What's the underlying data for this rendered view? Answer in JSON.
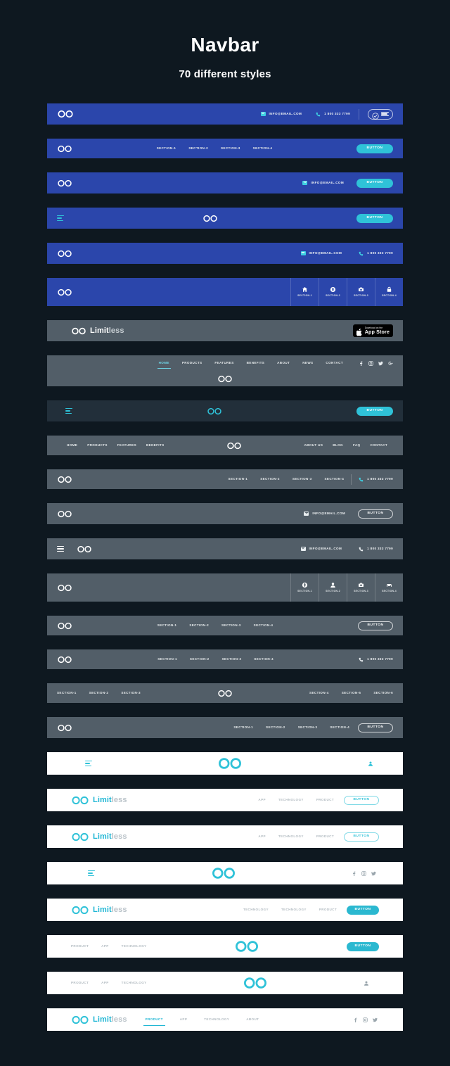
{
  "header": {
    "title": "Navbar",
    "subtitle": "70 different styles"
  },
  "colors": {
    "background": "#0e1820",
    "blue_bar": "#2b46ab",
    "gray_bar": "#525e68",
    "dark_bar": "#222f3a",
    "white_bar": "#ffffff",
    "accent_cyan": "#2fc2d8",
    "logo_cyan": "#1fb6d4"
  },
  "brand": {
    "logo_icon": "infinity-icon",
    "name_part1": "Limit",
    "name_part2": "less"
  },
  "common": {
    "email": "INFO@EMAIL.COM",
    "phone": "1 800 333 7799",
    "button": "BUTTON",
    "sections": [
      "SECTION-1",
      "SECTION-2",
      "SECTION-3",
      "SECTION-4"
    ],
    "sections6_left": [
      "SECTION-1",
      "SECTION-2",
      "SECTION-3"
    ],
    "sections6_right": [
      "SECTION-4",
      "SECTION-5",
      "SECTION-6"
    ]
  },
  "appstore": {
    "line1": "Download on the",
    "line2": "App Store"
  },
  "navbars": [
    {
      "index": 1,
      "style": "blue",
      "logo": "infinity-icon",
      "email": "INFO@EMAIL.COM",
      "phone": "1 800 333 7799",
      "badge": "checkmark-badge-icon"
    },
    {
      "index": 2,
      "style": "blue",
      "logo": "infinity-icon",
      "links": [
        "SECTION-1",
        "SECTION-2",
        "SECTION-3",
        "SECTION-4"
      ],
      "button": "BUTTON"
    },
    {
      "index": 3,
      "style": "blue",
      "logo": "infinity-icon",
      "email": "INFO@EMAIL.COM",
      "button": "BUTTON"
    },
    {
      "index": 4,
      "style": "blue",
      "menu": "hamburger-icon",
      "logo": "infinity-icon",
      "button": "BUTTON"
    },
    {
      "index": 5,
      "style": "blue",
      "logo": "infinity-icon",
      "email": "INFO@EMAIL.COM",
      "phone": "1 800 333 7799"
    },
    {
      "index": 6,
      "style": "blue",
      "logo": "infinity-icon",
      "tabs": [
        {
          "icon": "home-icon",
          "label": "SECTION-1"
        },
        {
          "icon": "globe-icon",
          "label": "SECTION-2"
        },
        {
          "icon": "camera-icon",
          "label": "SECTION-3"
        },
        {
          "icon": "lock-icon",
          "label": "SECTION-4"
        }
      ]
    },
    {
      "index": 7,
      "style": "gray",
      "logo": "infinity-icon",
      "brand1": "Limit",
      "brand2": "less",
      "appstore": true
    },
    {
      "index": 8,
      "style": "gray",
      "links": [
        "HOME",
        "PRODUCTS",
        "FEATURES",
        "BENEFITS",
        "ABOUT",
        "NEWS",
        "CONTACT"
      ],
      "active": "HOME",
      "social": [
        "facebook-icon",
        "instagram-icon",
        "twitter-icon",
        "google-plus-icon"
      ],
      "logo": "infinity-icon"
    },
    {
      "index": 9,
      "style": "dark",
      "menu": "hamburger-icon",
      "logo": "infinity-icon",
      "button": "BUTTON"
    },
    {
      "index": 10,
      "style": "gray",
      "links_left": [
        "HOME",
        "PRODUCTS",
        "FEATURES",
        "BENEFITS"
      ],
      "logo": "infinity-icon",
      "links_right": [
        "ABOUT US",
        "BLOG",
        "FAQ",
        "CONTACT"
      ]
    },
    {
      "index": 11,
      "style": "gray",
      "logo": "infinity-icon",
      "links": [
        "SECTION-1",
        "SECTION-2",
        "SECTION-3",
        "SECTION-4"
      ],
      "phone": "1 800 333 7799"
    },
    {
      "index": 12,
      "style": "gray",
      "logo": "infinity-icon",
      "email": "INFO@EMAIL.COM",
      "button": "BUTTON"
    },
    {
      "index": 13,
      "style": "gray",
      "menu": "hamburger-icon",
      "logo": "infinity-icon",
      "email": "INFO@EMAIL.COM",
      "phone": "1 800 333 7799"
    },
    {
      "index": 14,
      "style": "gray",
      "logo": "infinity-icon",
      "tabs": [
        {
          "icon": "globe-icon",
          "label": "SECTION-1"
        },
        {
          "icon": "person-icon",
          "label": "SECTION-2"
        },
        {
          "icon": "camera-icon",
          "label": "SECTION-3"
        },
        {
          "icon": "car-icon",
          "label": "SECTION-4"
        }
      ]
    },
    {
      "index": 15,
      "style": "gray",
      "logo": "infinity-icon",
      "links": [
        "SECTION-1",
        "SECTION-2",
        "SECTION-3",
        "SECTION-4"
      ],
      "button": "BUTTON"
    },
    {
      "index": 16,
      "style": "gray",
      "logo": "infinity-icon",
      "links": [
        "SECTION-1",
        "SECTION-2",
        "SECTION-3",
        "SECTION-4"
      ],
      "phone": "1 800 333 7799"
    },
    {
      "index": 17,
      "style": "gray",
      "links_left": [
        "SECTION-1",
        "SECTION-2",
        "SECTION-3"
      ],
      "logo": "infinity-icon",
      "links_right": [
        "SECTION-4",
        "SECTION-5",
        "SECTION-6"
      ]
    },
    {
      "index": 18,
      "style": "gray",
      "logo": "infinity-icon",
      "links": [
        "SECTION-1",
        "SECTION-2",
        "SECTION-3",
        "SECTION-4"
      ],
      "button": "BUTTON"
    },
    {
      "index": 19,
      "style": "white",
      "menu": "hamburger-icon",
      "logo": "infinity-icon",
      "account": "person-icon"
    },
    {
      "index": 20,
      "style": "white",
      "logo": "infinity-icon",
      "brand1": "Limit",
      "brand2": "less",
      "links": [
        "APP",
        "TECHNOLOGY",
        "PRODUCT"
      ],
      "button": "BUTTON"
    },
    {
      "index": 21,
      "style": "white",
      "logo": "infinity-icon",
      "brand1": "Limit",
      "brand2": "less",
      "links": [
        "APP",
        "TECHNOLOGY",
        "PRODUCT"
      ],
      "button": "BUTTON"
    },
    {
      "index": 22,
      "style": "white",
      "menu": "hamburger-icon",
      "logo": "infinity-icon",
      "social": [
        "facebook-icon",
        "instagram-icon",
        "twitter-icon"
      ]
    },
    {
      "index": 23,
      "style": "white",
      "logo": "infinity-icon",
      "brand1": "Limit",
      "brand2": "less",
      "links": [
        "TECHNOLOGY",
        "TECHNOLOGY",
        "PRODUCT"
      ],
      "button": "BUTTON"
    },
    {
      "index": 24,
      "style": "white",
      "links": [
        "PRODUCT",
        "APP",
        "TECHNOLOGY"
      ],
      "logo": "infinity-icon",
      "button": "BUTTON"
    },
    {
      "index": 25,
      "style": "white",
      "links": [
        "PRODUCT",
        "APP",
        "TECHNOLOGY"
      ],
      "logo": "infinity-icon",
      "account": "person-icon"
    },
    {
      "index": 26,
      "style": "white",
      "logo": "infinity-icon",
      "brand1": "Limit",
      "brand2": "less",
      "links": [
        "PRODUCT",
        "APP",
        "TECHNOLOGY",
        "ABOUT"
      ],
      "active": "PRODUCT",
      "social": [
        "facebook-icon",
        "instagram-icon",
        "twitter-icon"
      ]
    }
  ]
}
